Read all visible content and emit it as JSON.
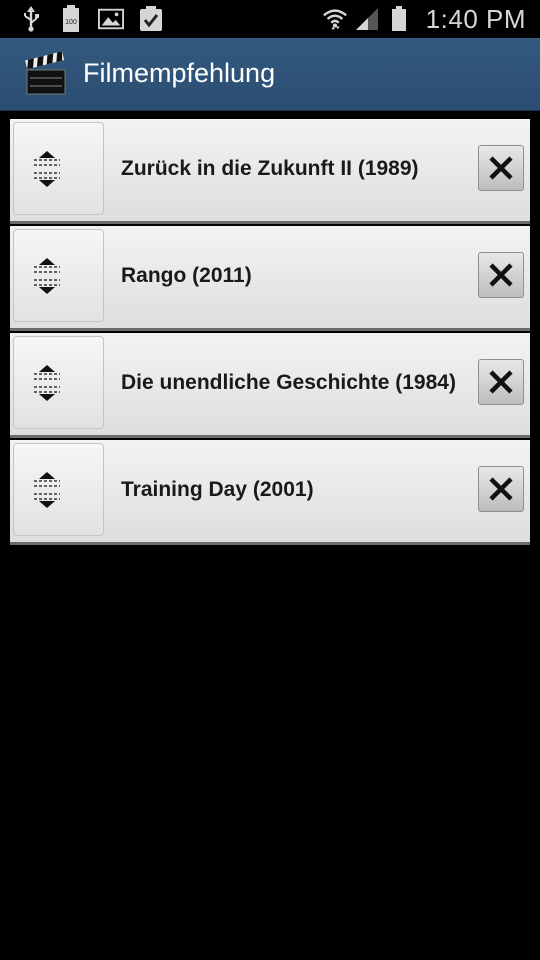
{
  "status_bar": {
    "time": "1:40 PM",
    "icons": [
      "usb-icon",
      "battery-full-icon",
      "image-icon",
      "clipboard-check-icon",
      "wifi-icon",
      "signal-icon",
      "battery-icon"
    ],
    "battery_label": "100"
  },
  "action_bar": {
    "title": "Filmempfehlung",
    "icon": "clapperboard-icon",
    "background": "#2f5479"
  },
  "movies": [
    {
      "title": "Zurück in die Zukunft II (1989)"
    },
    {
      "title": "Rango (2011)"
    },
    {
      "title": "Die unendliche Geschichte (1984)"
    },
    {
      "title": "Training Day (2001)"
    }
  ]
}
